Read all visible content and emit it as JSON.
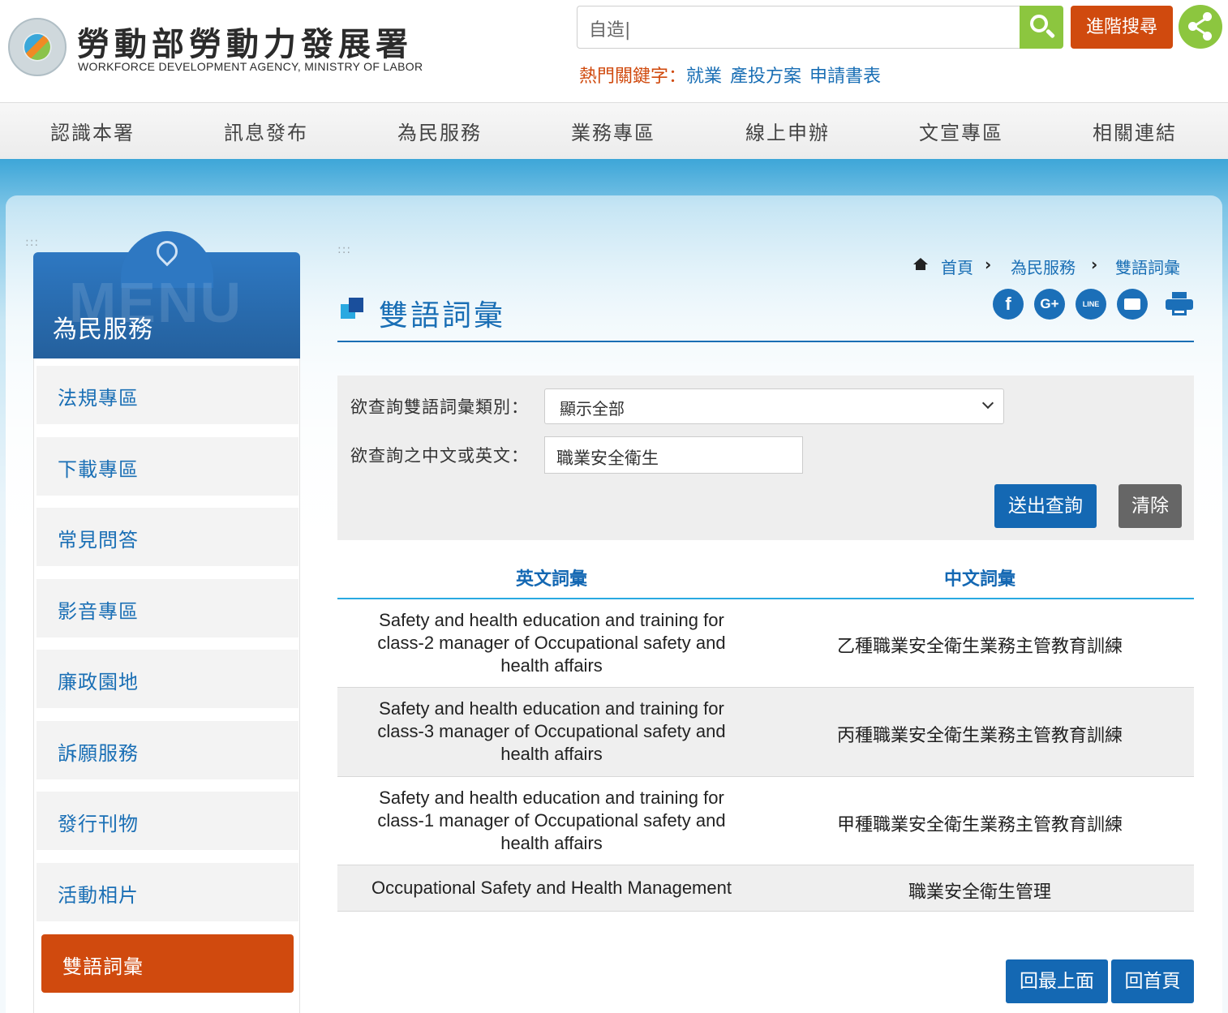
{
  "header": {
    "logo_title": "勞動部勞動力發展署",
    "logo_subtitle": "WORKFORCE DEVELOPMENT AGENCY, MINISTRY OF LABOR",
    "search_value": "自造|",
    "advanced_search_label": "進階搜尋",
    "hot_keywords_label": "熱門關鍵字：",
    "hot_keywords": [
      "就業",
      "產投方案",
      "申請書表"
    ]
  },
  "nav": {
    "items": [
      "認識本署",
      "訊息發布",
      "為民服務",
      "業務專區",
      "線上申辦",
      "文宣專區",
      "相關連結"
    ]
  },
  "sidebar": {
    "watermark": "MENU",
    "title": "為民服務",
    "items": [
      {
        "label": "法規專區"
      },
      {
        "label": "下載專區"
      },
      {
        "label": "常見問答"
      },
      {
        "label": "影音專區"
      },
      {
        "label": "廉政園地"
      },
      {
        "label": "訴願服務"
      },
      {
        "label": "發行刊物"
      },
      {
        "label": "活動相片"
      },
      {
        "label": "雙語詞彙"
      }
    ],
    "active_index": 8
  },
  "breadcrumb": {
    "items": [
      "首頁",
      "為民服務",
      "雙語詞彙"
    ],
    "separator": "›"
  },
  "page": {
    "title": "雙語詞彙"
  },
  "social": {
    "facebook": "f",
    "google": "G+",
    "line": "LINE"
  },
  "form": {
    "category_label": "欲查詢雙語詞彙類別：",
    "category_value": "顯示全部",
    "query_label": "欲查詢之中文或英文：",
    "query_value": "職業安全衛生",
    "submit_label": "送出查詢",
    "clear_label": "清除"
  },
  "table": {
    "headers": [
      "英文詞彙",
      "中文詞彙"
    ],
    "rows": [
      {
        "en_lines": [
          "Safety and health education and training for",
          "class-2 manager of Occupational safety and",
          "health affairs"
        ],
        "zh": "乙種職業安全衛生業務主管教育訓練"
      },
      {
        "en_lines": [
          "Safety and health education and training for",
          "class-3 manager of Occupational safety and",
          "health affairs"
        ],
        "zh": "丙種職業安全衛生業務主管教育訓練"
      },
      {
        "en_lines": [
          "Safety and health education and training for",
          "class-1 manager of Occupational safety and",
          "health affairs"
        ],
        "zh": "甲種職業安全衛生業務主管教育訓練"
      },
      {
        "en_lines": [
          "Occupational Safety and Health Management"
        ],
        "zh": "職業安全衛生管理"
      }
    ]
  },
  "footer_buttons": {
    "back_to_top": "回最上面",
    "back_home": "回首頁"
  },
  "colors": {
    "brand_blue": "#1468b3",
    "accent_orange": "#d04a0e",
    "accent_green": "#8cc63f"
  }
}
